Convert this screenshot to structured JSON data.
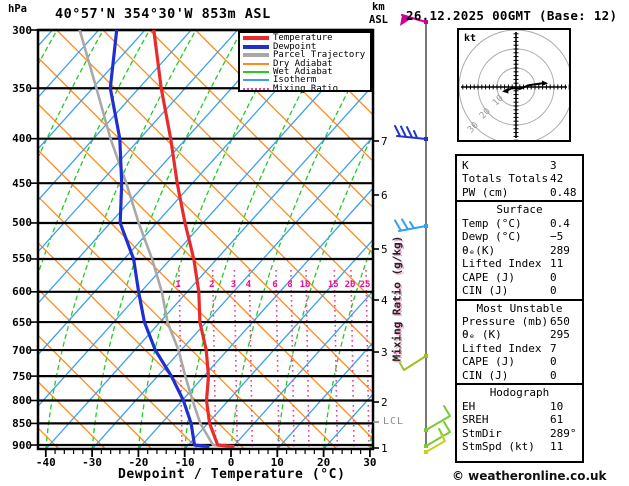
{
  "header": {
    "pressure_unit": "hPa",
    "title": "40°57'N 354°30'W 853m ASL",
    "alt_unit_line1": "km",
    "alt_unit_line2": "ASL",
    "date": "26.12.2025 00GMT (Base: 12)"
  },
  "legend": {
    "items": [
      {
        "label": "Temperature",
        "color": "#e82c2c",
        "kind": "thick"
      },
      {
        "label": "Dewpoint",
        "color": "#2030d0",
        "kind": "thick"
      },
      {
        "label": "Parcel Trajectory",
        "color": "#a8a8a8",
        "kind": "thick"
      },
      {
        "label": "Dry Adiabat",
        "color": "#ff8c1a",
        "kind": "thin"
      },
      {
        "label": "Wet Adiabat",
        "color": "#22cc22",
        "kind": "thin"
      },
      {
        "label": "Isotherm",
        "color": "#3aa0f0",
        "kind": "thin"
      },
      {
        "label": "Mixing Ratio",
        "color": "#f23c9b",
        "kind": "dotted"
      }
    ]
  },
  "axes": {
    "pressure_ticks": [
      300,
      350,
      400,
      450,
      500,
      550,
      600,
      650,
      700,
      750,
      800,
      850,
      900
    ],
    "temp_ticks": [
      -40,
      -30,
      -20,
      -10,
      0,
      10,
      20,
      30
    ],
    "x_axis_title": "Dewpoint / Temperature (°C)",
    "km_ticks": [
      1,
      2,
      3,
      4,
      5,
      6,
      7
    ],
    "lcl_label": "LCL",
    "mixing_ratio_labels": [
      1,
      2,
      3,
      4,
      6,
      8,
      10,
      15,
      20,
      25
    ],
    "mixing_ratio_axis_label": "Mixing Ratio (g/kg)"
  },
  "chart_data": {
    "type": "line",
    "subtype": "skew-t_log-p_sounding",
    "title": "40°57'N 354°30'W 853m ASL",
    "valid": "26.12.2025 00GMT (Base: 12)",
    "xlabel": "Dewpoint / Temperature (°C)",
    "x_range_C": [
      -45,
      38
    ],
    "pressure_range_hPa": [
      300,
      900
    ],
    "grid": "skew-t background: isotherms, dry adiabats, wet adiabats, mixing ratio lines",
    "pressure_levels_hPa": [
      300,
      350,
      400,
      450,
      500,
      550,
      600,
      650,
      700,
      750,
      800,
      850,
      900
    ],
    "series": [
      {
        "name": "Temperature",
        "color": "#e82c2c",
        "values_C": [
          -41,
          -36,
          -31,
          -27,
          -23,
          -19,
          -16,
          -14,
          -11,
          -9,
          -8,
          -6,
          -3
        ]
      },
      {
        "name": "Dewpoint",
        "color": "#2030d0",
        "values_C": [
          -49,
          -47,
          -42,
          -39,
          -37,
          -32,
          -29,
          -26,
          -22,
          -17,
          -13,
          -10,
          -8
        ]
      },
      {
        "name": "Parcel Trajectory",
        "color": "#a8a8a8",
        "values_C": [
          -57,
          -50,
          -44,
          -38,
          -33,
          -28,
          -24,
          -21,
          -17,
          -14,
          -11,
          -8,
          -4
        ]
      }
    ],
    "surface": {
      "temp_C": 0.4,
      "dewp_C": -5,
      "station_alt_m_ASL": 853
    },
    "lcl_alt_between_km": [
      1,
      2
    ],
    "wind_profile_barbs": [
      {
        "idx": 0,
        "color": "#cc0099",
        "note": "flag, upper level"
      },
      {
        "idx": 1,
        "color": "#2233cc",
        "note": "3.5 barbs ~ 7 km"
      },
      {
        "idx": 2,
        "color": "#33a0ee",
        "note": "2.5 barbs ~ 5.5 km"
      },
      {
        "idx": 3,
        "color": "#9cc222",
        "note": "1 barb ~ 3 km"
      },
      {
        "idx": 4,
        "color": "#77cc33",
        "note": "low level"
      },
      {
        "idx": 5,
        "color": "#77cc33",
        "note": "low level"
      },
      {
        "idx": 6,
        "color": "#cccc22",
        "note": "near surface"
      }
    ]
  },
  "hodograph": {
    "unit_label": "kt",
    "ring_labels": [
      "10",
      "20",
      "30"
    ],
    "rings_kt": [
      10,
      20,
      30
    ],
    "trace_kt_uv": [
      [
        -5,
        -2
      ],
      [
        -2,
        -0.5
      ],
      [
        2,
        -1
      ],
      [
        7,
        1
      ],
      [
        14,
        2
      ]
    ]
  },
  "panel": {
    "sections": [
      {
        "header": null,
        "rows": [
          [
            "K",
            "3"
          ],
          [
            "Totals Totals",
            "42"
          ],
          [
            "PW (cm)",
            "0.48"
          ]
        ]
      },
      {
        "header": "Surface",
        "rows": [
          [
            "Temp (°C)",
            "0.4"
          ],
          [
            "Dewp (°C)",
            "−5"
          ],
          [
            "θₑ(K)",
            "289"
          ],
          [
            "Lifted Index",
            "11"
          ],
          [
            "CAPE (J)",
            "0"
          ],
          [
            "CIN (J)",
            "0"
          ]
        ]
      },
      {
        "header": "Most Unstable",
        "rows": [
          [
            "Pressure (mb)",
            "650"
          ],
          [
            "θₑ (K)",
            "295"
          ],
          [
            "Lifted Index",
            "7"
          ],
          [
            "CAPE (J)",
            "0"
          ],
          [
            "CIN (J)",
            "0"
          ]
        ]
      },
      {
        "header": "Hodograph",
        "rows": [
          [
            "EH",
            "10"
          ],
          [
            "SREH",
            "61"
          ],
          [
            "StmDir",
            "289°"
          ],
          [
            "StmSpd (kt)",
            "11"
          ]
        ]
      }
    ]
  },
  "footer": {
    "copyright": "© weatheronline.co.uk"
  },
  "colors": {
    "temperature": "#e82c2c",
    "dewpoint": "#2030d0",
    "parcel": "#a8a8a8",
    "dry_adiabat": "#ff8c1a",
    "wet_adiabat": "#22cc22",
    "isotherm": "#3aa0f0",
    "mixing_ratio": "#f23c9b",
    "mixing_label": "#ee0f8e",
    "grid": "#000000",
    "barb_line": "#777777",
    "hodo_ring": "#aaaaaa",
    "lcl": "#8a8a8a"
  }
}
